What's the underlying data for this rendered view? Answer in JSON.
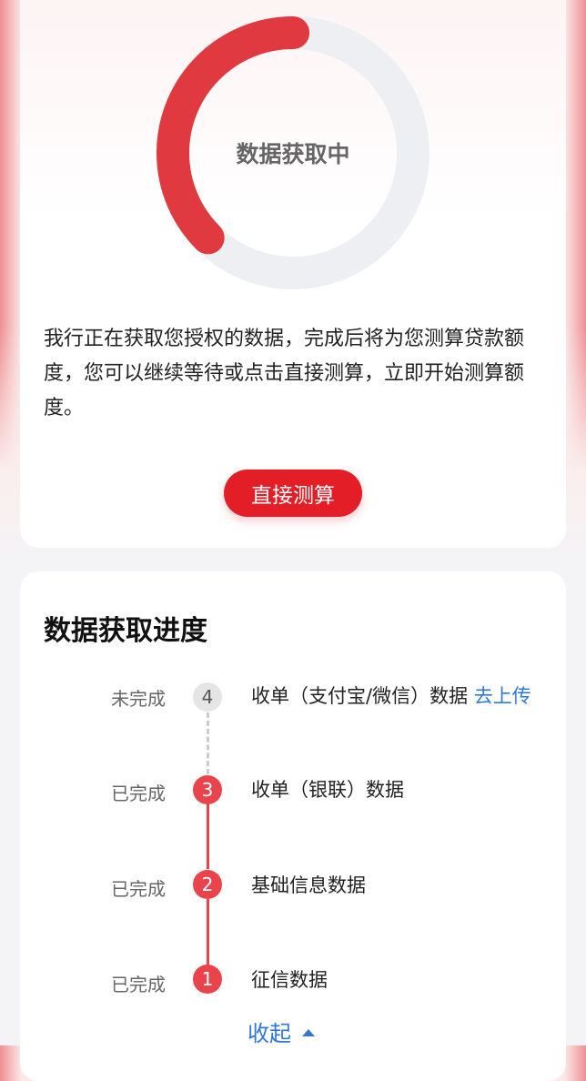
{
  "summary": {
    "ring_label": "数据获取中",
    "ring_progress": 0.375,
    "description": "我行正在获取您授权的数据，完成后将为您测算贷款额度，您可以继续等待或点击直接测算，立即开始测算额度。",
    "button_label": "直接测算"
  },
  "progress": {
    "title": "数据获取进度",
    "steps": [
      {
        "number": "4",
        "status": "未完成",
        "text": "收单（支付宝/微信）数据",
        "link": "去上传"
      },
      {
        "number": "3",
        "status": "已完成",
        "text": "收单（银联）数据"
      },
      {
        "number": "2",
        "status": "已完成",
        "text": "基础信息数据"
      },
      {
        "number": "1",
        "status": "已完成",
        "text": "征信数据"
      }
    ],
    "collapse_label": "收起"
  },
  "colors": {
    "accent_red": "#e31e26",
    "link_blue": "#2f78d8",
    "ring_track": "#eeeff3"
  }
}
